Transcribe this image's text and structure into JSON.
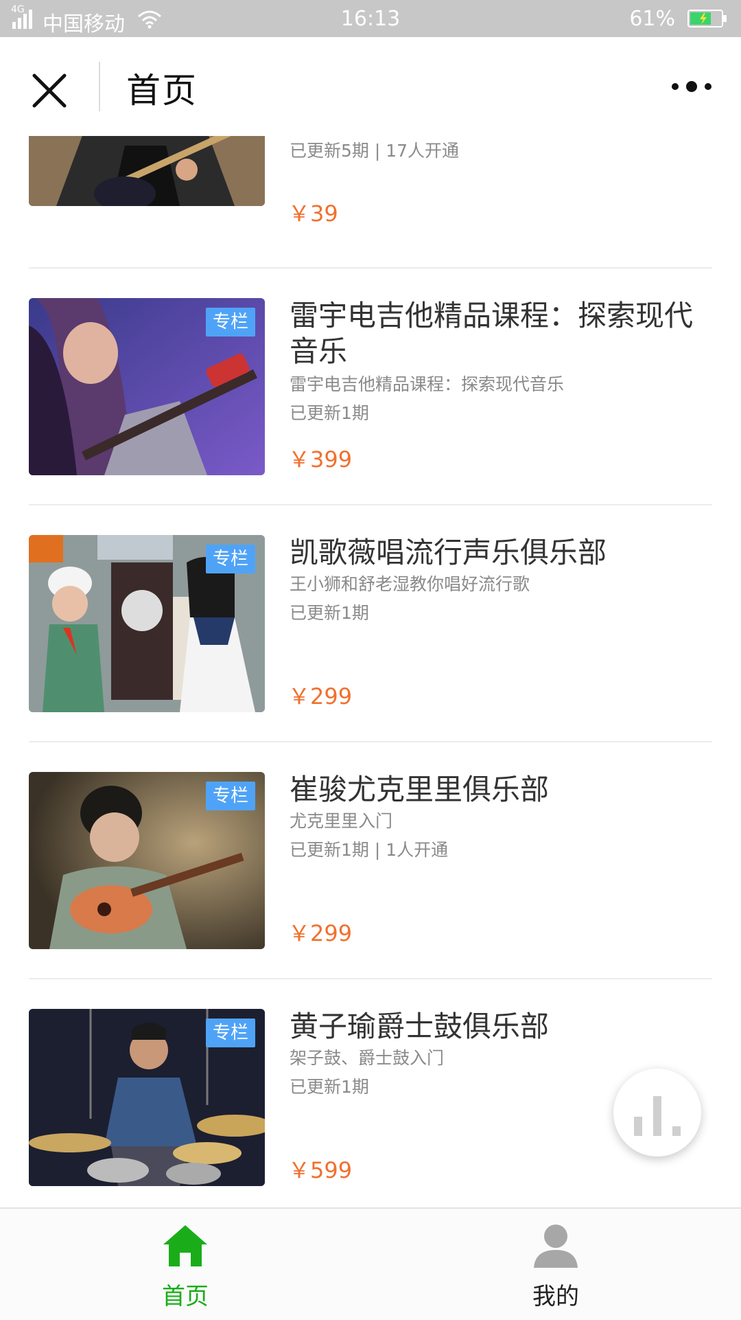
{
  "status_bar": {
    "network": "4G",
    "carrier": "中国移动",
    "time": "16:13",
    "battery": "61%"
  },
  "header": {
    "title": "首页",
    "close_icon": "close-icon",
    "more_icon": "more-icon"
  },
  "courses": [
    {
      "title": "",
      "subtitle": "",
      "meta": "已更新5期 | 17人开通",
      "price": "￥39",
      "badge": ""
    },
    {
      "title": "雷宇电吉他精品课程：探索现代音乐",
      "subtitle": "雷宇电吉他精品课程：探索现代音乐",
      "meta": "已更新1期",
      "price": "￥399",
      "badge": "专栏"
    },
    {
      "title": "凯歌薇唱流行声乐俱乐部",
      "subtitle": "王小狮和舒老湿教你唱好流行歌",
      "meta": "已更新1期",
      "price": "￥299",
      "badge": "专栏"
    },
    {
      "title": "崔骏尤克里里俱乐部",
      "subtitle": "尤克里里入门",
      "meta": "已更新1期 | 1人开通",
      "price": "￥299",
      "badge": "专栏"
    },
    {
      "title": "黄子瑜爵士鼓俱乐部",
      "subtitle": "架子鼓、爵士鼓入门",
      "meta": "已更新1期",
      "price": "￥599",
      "badge": "专栏"
    }
  ],
  "fab": {
    "icon": "bar-chart-icon"
  },
  "tabs": [
    {
      "label": "首页",
      "icon": "home-icon",
      "active": true
    },
    {
      "label": "我的",
      "icon": "user-icon",
      "active": false
    }
  ],
  "colors": {
    "accent_green": "#1aad19",
    "price_orange": "#f0702e",
    "badge_blue": "#4fa3f7",
    "status_bar": "#c7c7c7"
  }
}
